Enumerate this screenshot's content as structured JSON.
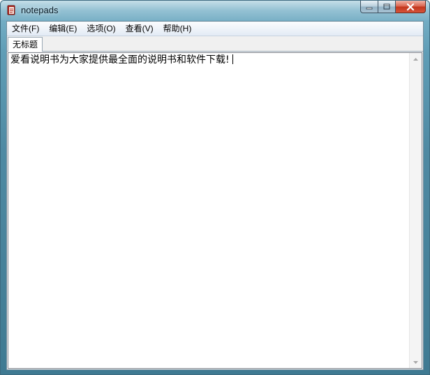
{
  "window": {
    "title": "notepads",
    "app_icon": "notepad-icon",
    "buttons": {
      "minimize_icon": "minimize-icon",
      "maximize_icon": "maximize-icon",
      "close_icon": "close-icon"
    },
    "colors": {
      "frame": "#4f8aa3",
      "close_button": "#c1351c"
    }
  },
  "menu": {
    "items": [
      {
        "label": "文件(F)"
      },
      {
        "label": "编辑(E)"
      },
      {
        "label": "选项(O)"
      },
      {
        "label": "查看(V)"
      },
      {
        "label": "帮助(H)"
      }
    ]
  },
  "tabs": [
    {
      "label": "无标题",
      "active": true
    }
  ],
  "editor": {
    "content": "爱看说明书为大家提供最全面的说明书和软件下载!"
  }
}
